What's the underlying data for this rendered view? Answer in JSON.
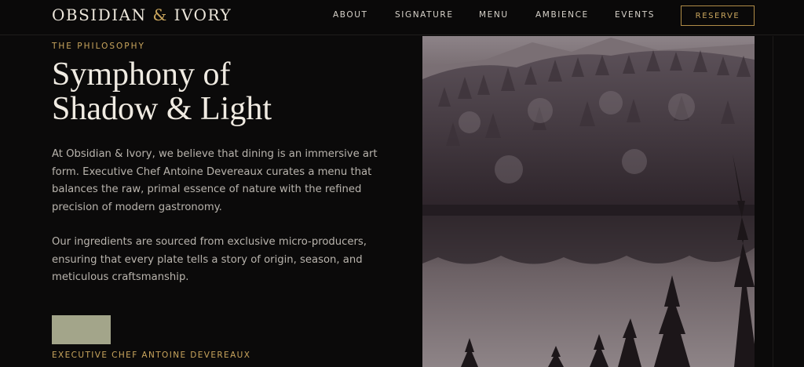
{
  "brand": {
    "name_part1": "OBSIDIAN",
    "ampersand": "&",
    "name_part2": "IVORY"
  },
  "nav": {
    "items": [
      {
        "label": "ABOUT"
      },
      {
        "label": "SIGNATURE"
      },
      {
        "label": "MENU"
      },
      {
        "label": "AMBIENCE"
      },
      {
        "label": "EVENTS"
      }
    ],
    "reserve_label": "RESERVE"
  },
  "philosophy": {
    "eyebrow": "THE PHILOSOPHY",
    "headline_line1": "Symphony of",
    "headline_line2": "Shadow & Light",
    "paragraph1": "At Obsidian & Ivory, we believe that dining is an immersive art form. Executive Chef Antoine Devereaux curates a menu that balances the raw, primal essence of nature with the refined precision of modern gastronomy.",
    "paragraph2": "Our ingredients are sourced from exclusive micro-producers, ensuring that every plate tells a story of origin, season, and meticulous craftsmanship.",
    "chef_caption": "EXECUTIVE CHEF ANTOINE DEVEREAUX"
  },
  "colors": {
    "background": "#0b0a0a",
    "accent_gold": "#c9a55d",
    "text_primary": "#f0ebe2",
    "text_body": "#b9b4ad",
    "chef_placeholder": "#a3a58a"
  },
  "icons": {
    "hero_image": "forest-lake-photo"
  }
}
